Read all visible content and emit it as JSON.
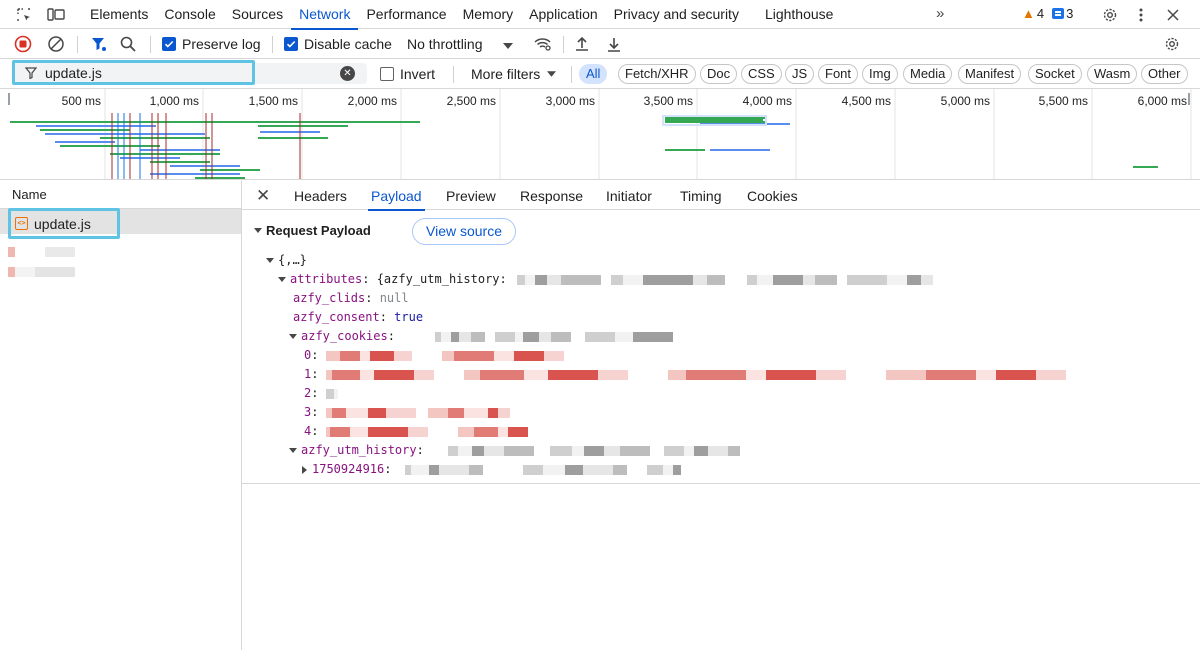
{
  "tabs": [
    "Elements",
    "Console",
    "Sources",
    "Network",
    "Performance",
    "Memory",
    "Application",
    "Privacy and security",
    "Lighthouse"
  ],
  "active_tab": "Network",
  "more_tabs": "»",
  "warnings_count": "4",
  "messages_count": "3",
  "toolbar": {
    "preserve_log": "Preserve log",
    "disable_cache": "Disable cache",
    "throttling": "No throttling"
  },
  "filter": {
    "value": "update.js",
    "invert_label": "Invert",
    "more_filters": "More filters",
    "types": [
      "All",
      "Fetch/XHR",
      "Doc",
      "CSS",
      "JS",
      "Font",
      "Img",
      "Media",
      "Manifest",
      "Socket",
      "Wasm",
      "Other"
    ],
    "active_type": "All"
  },
  "overview": {
    "ticks": [
      "500 ms",
      "1,000 ms",
      "1,500 ms",
      "2,000 ms",
      "2,500 ms",
      "3,000 ms",
      "3,500 ms",
      "4,000 ms",
      "4,500 ms",
      "5,000 ms",
      "5,500 ms",
      "6,000 ms"
    ],
    "colors": {
      "green": "#34a853",
      "blue": "#5b8def",
      "red": "#a52a2a",
      "blue_line": "#1a73e8"
    }
  },
  "requests": {
    "header": "Name",
    "selected": "update.js"
  },
  "detail_tabs": [
    "Headers",
    "Payload",
    "Preview",
    "Response",
    "Initiator",
    "Timing",
    "Cookies"
  ],
  "active_detail_tab": "Payload",
  "payload": {
    "section_title": "Request Payload",
    "view_source": "View source",
    "root": "{,…}",
    "attributes_key": "attributes",
    "attributes_preview": "{azfy_utm_history:",
    "clids_key": "azfy_clids",
    "clids_value": "null",
    "consent_key": "azfy_consent",
    "consent_value": "true",
    "cookies_key": "azfy_cookies",
    "cookie_indices": [
      "0",
      "1",
      "2",
      "3",
      "4"
    ],
    "utm_key": "azfy_utm_history",
    "utm_entry_key": "1750924916"
  }
}
